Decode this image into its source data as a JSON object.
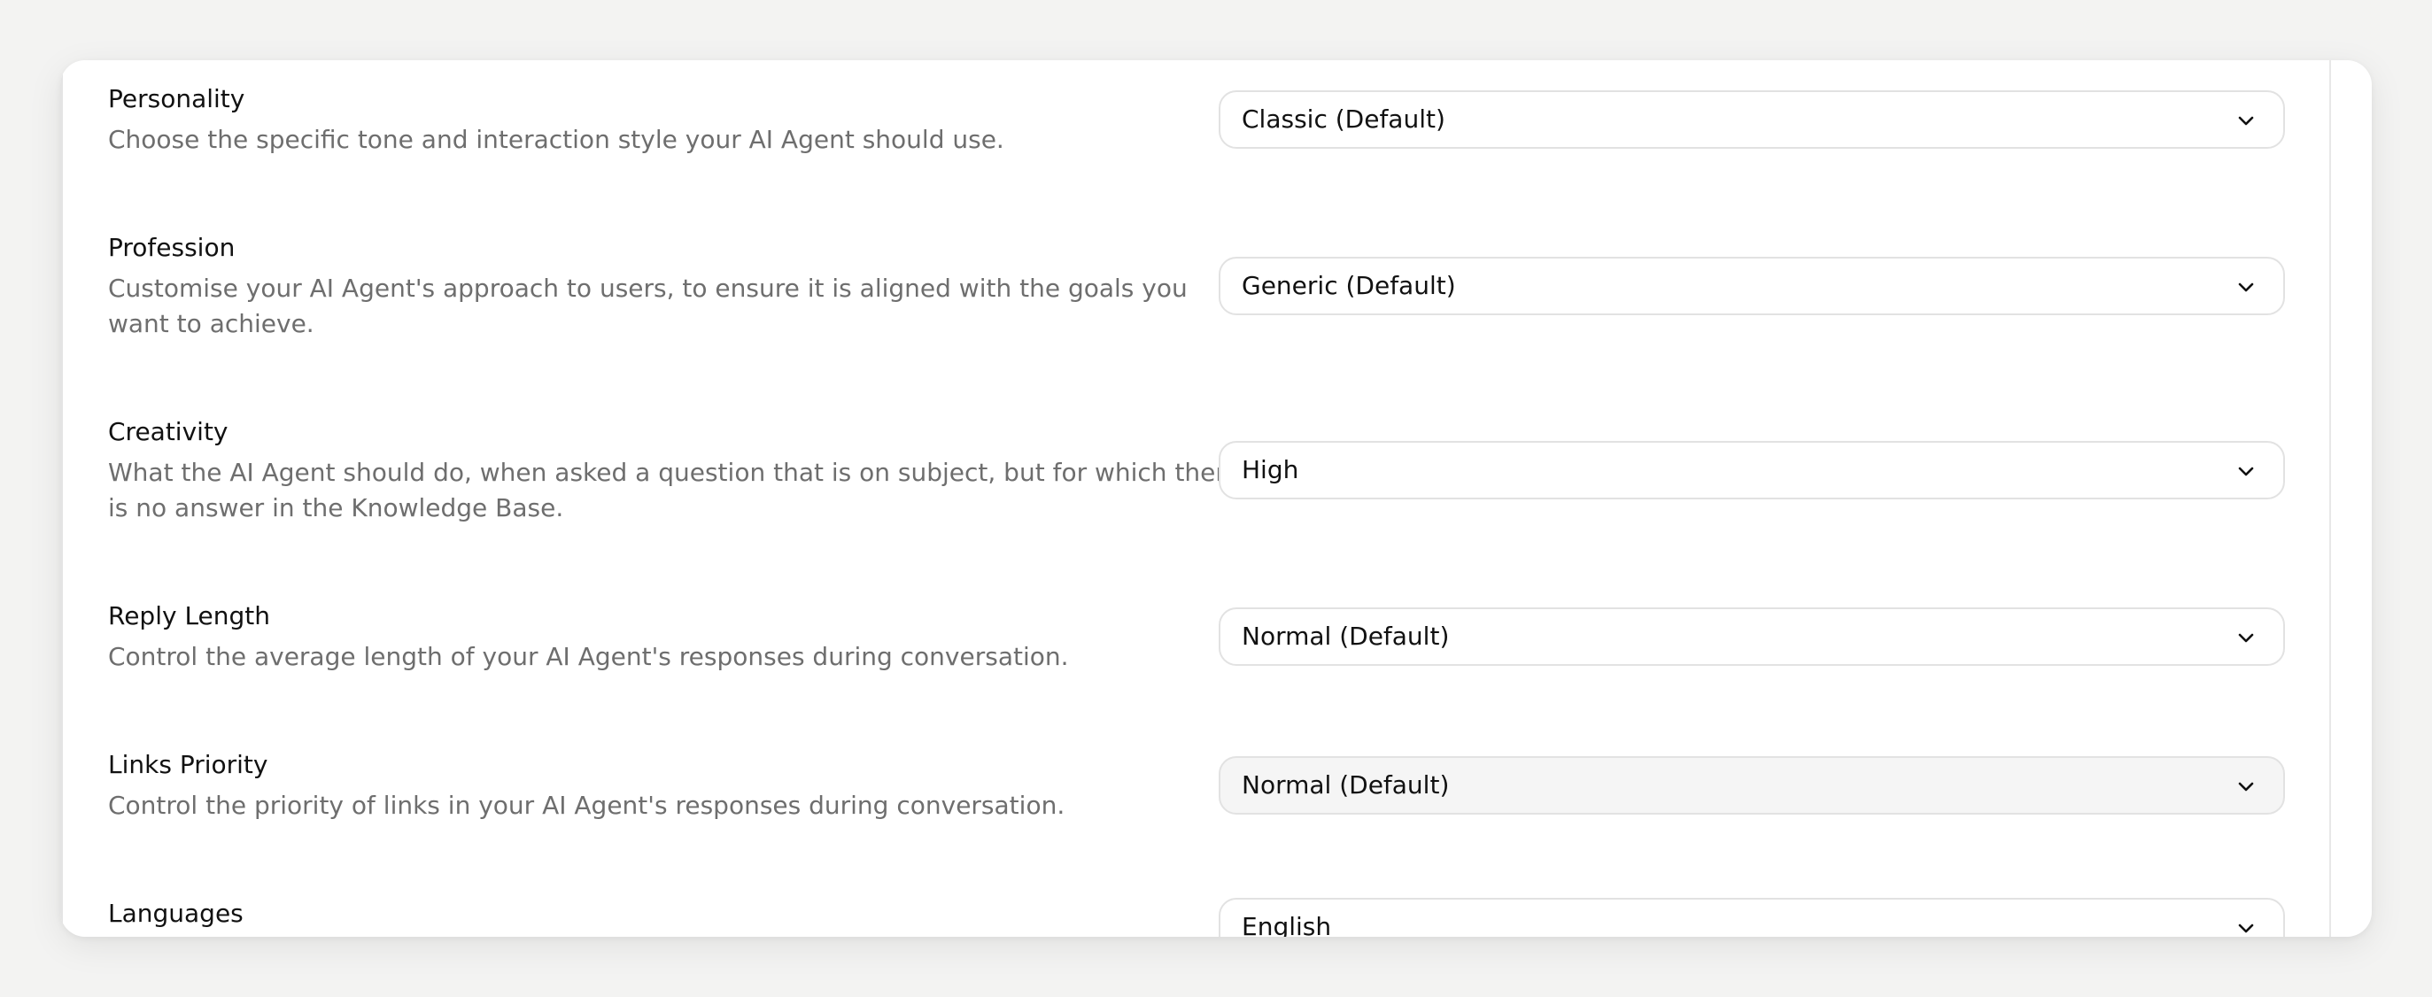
{
  "settings": [
    {
      "title": "Personality",
      "description": "Choose the specific tone and interaction style your AI Agent should use.",
      "value": "Classic (Default)"
    },
    {
      "title": "Profession",
      "description": "Customise your AI Agent's approach to users, to ensure it is aligned with the goals you want to achieve.",
      "value": "Generic (Default)"
    },
    {
      "title": "Creativity",
      "description": "What the AI Agent should do, when asked a question that is on subject, but for which there is no answer in the Knowledge Base.",
      "value": "High"
    },
    {
      "title": "Reply Length",
      "description": "Control the average length of your AI Agent's responses during conversation.",
      "value": "Normal (Default)"
    },
    {
      "title": "Links Priority",
      "description": "Control the priority of links in your AI Agent's responses during conversation.",
      "value": "Normal (Default)"
    },
    {
      "title": "Languages",
      "description": "",
      "value": "English"
    }
  ],
  "icons": {
    "chevron": "chevron-down-icon"
  },
  "colors": {
    "background": "#f3f3f2",
    "card": "#ffffff",
    "border": "#e2e2e2",
    "title": "#111111",
    "description": "#6e6e6e",
    "hover_select": "#f5f5f5"
  }
}
